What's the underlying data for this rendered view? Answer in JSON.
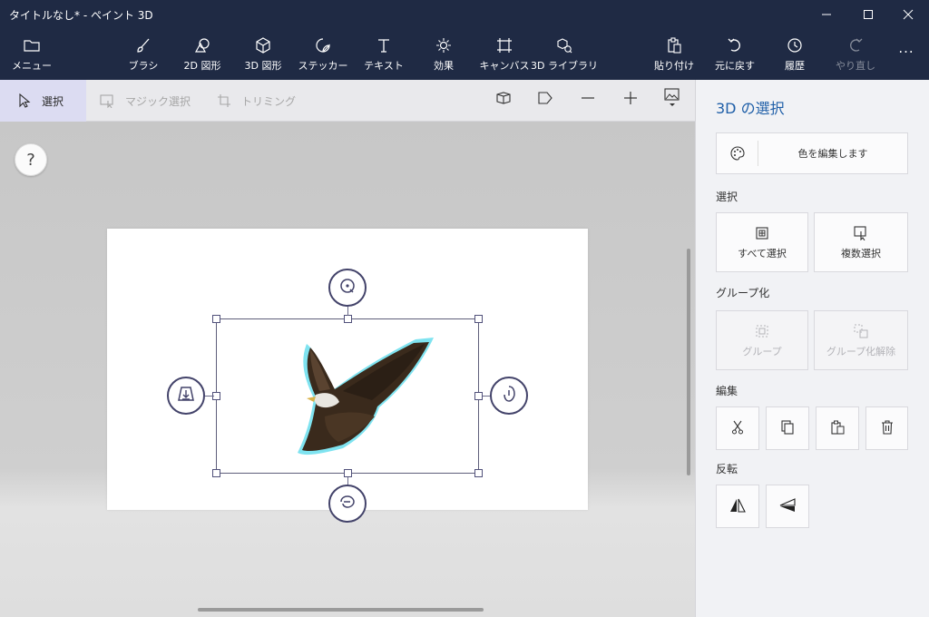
{
  "window": {
    "title": "タイトルなし* - ペイント 3D",
    "controls": [
      "minimize",
      "maximize",
      "close"
    ]
  },
  "ribbon": {
    "items": [
      {
        "label": "メニュー",
        "icon": "folder-icon"
      },
      {
        "label": "ブラシ",
        "icon": "brush-icon"
      },
      {
        "label": "2D 図形",
        "icon": "2d-shapes-icon"
      },
      {
        "label": "3D 図形",
        "icon": "3d-shapes-icon"
      },
      {
        "label": "ステッカー",
        "icon": "sticker-icon"
      },
      {
        "label": "テキスト",
        "icon": "text-icon"
      },
      {
        "label": "効果",
        "icon": "effects-icon"
      },
      {
        "label": "キャンバス",
        "icon": "canvas-icon"
      },
      {
        "label": "3D ライブラリ",
        "icon": "3d-library-icon"
      },
      {
        "label": "貼り付け",
        "icon": "paste-icon"
      },
      {
        "label": "元に戻す",
        "icon": "undo-icon"
      },
      {
        "label": "履歴",
        "icon": "history-icon"
      },
      {
        "label": "やり直し",
        "icon": "redo-icon"
      }
    ],
    "more": "..."
  },
  "toolbar": {
    "select": "選択",
    "magic_select": "マジック選択",
    "crop": "トリミング"
  },
  "canvas": {
    "help": "?"
  },
  "panel": {
    "title": "3D の選択",
    "edit_color": "色を編集します",
    "section_select": "選択",
    "select_all": "すべて選択",
    "multi_select": "複数選択",
    "section_group": "グループ化",
    "group": "グループ",
    "ungroup": "グループ化解除",
    "section_edit": "編集",
    "section_flip": "反転"
  },
  "colors": {
    "titlebar": "#1f2a44",
    "accent": "#1f5fa8",
    "selection_glow": "#7fe3f0"
  }
}
